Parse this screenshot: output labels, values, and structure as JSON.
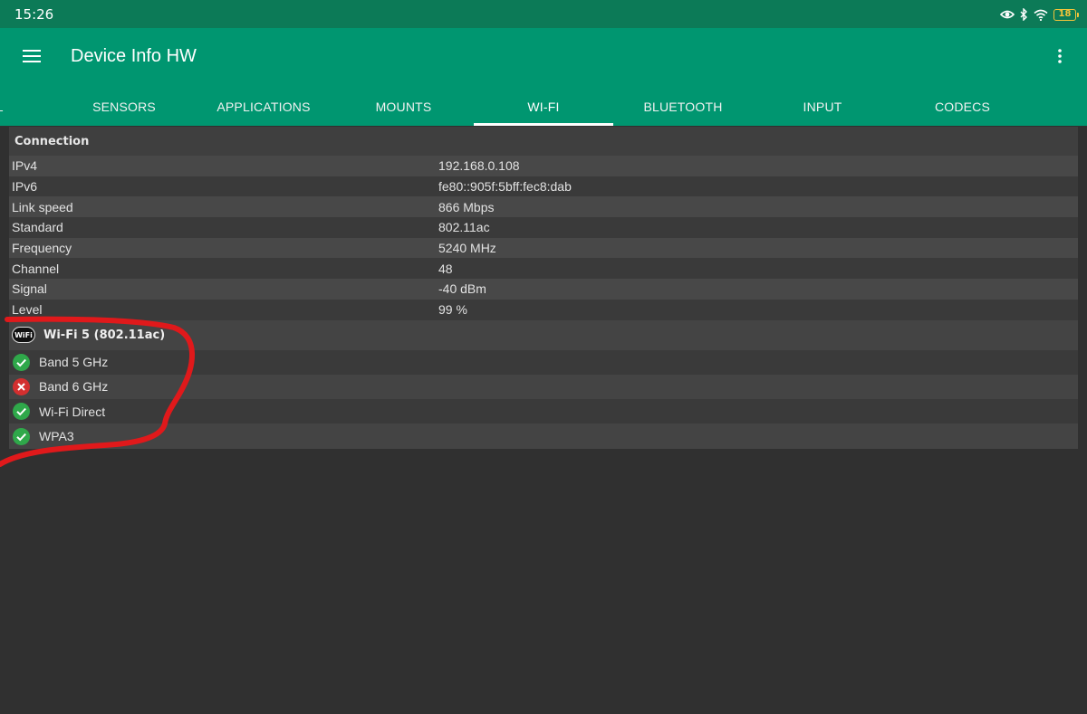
{
  "status_bar": {
    "time": "15:26",
    "icons": [
      "eye-icon",
      "bluetooth-icon",
      "wifi-signal-icon"
    ],
    "battery": "18"
  },
  "app_bar": {
    "title": "Device Info HW",
    "menu_icon": "hamburger-menu-icon",
    "overflow_icon": "more-vert-icon"
  },
  "tabs": [
    {
      "label": "AL"
    },
    {
      "label": "SENSORS"
    },
    {
      "label": "APPLICATIONS"
    },
    {
      "label": "MOUNTS"
    },
    {
      "label": "WI-FI",
      "active": true
    },
    {
      "label": "BLUETOOTH"
    },
    {
      "label": "INPUT"
    },
    {
      "label": "CODECS"
    }
  ],
  "connection": {
    "header": "Connection",
    "rows": [
      {
        "label": "IPv4",
        "value": "192.168.0.108"
      },
      {
        "label": "IPv6",
        "value": "fe80::905f:5bff:fec8:dab"
      },
      {
        "label": "Link speed",
        "value": "866 Mbps"
      },
      {
        "label": "Standard",
        "value": "802.11ac"
      },
      {
        "label": "Frequency",
        "value": "5240 MHz"
      },
      {
        "label": "Channel",
        "value": "48"
      },
      {
        "label": "Signal",
        "value": "-40 dBm"
      },
      {
        "label": "Level",
        "value": "99 %"
      }
    ]
  },
  "wifi_features": {
    "badge": "WiFi",
    "header": "Wi-Fi 5 (802.11ac)",
    "items": [
      {
        "label": "Band 5 GHz",
        "supported": true
      },
      {
        "label": "Band 6 GHz",
        "supported": false
      },
      {
        "label": "Wi-Fi Direct",
        "supported": true
      },
      {
        "label": "WPA3",
        "supported": true
      }
    ]
  },
  "colors": {
    "status_bar": "#0c7a57",
    "app_bar": "#009670",
    "supported": "#2fa84a",
    "unsupported": "#d32f2f",
    "annotation": "#e0191b"
  }
}
